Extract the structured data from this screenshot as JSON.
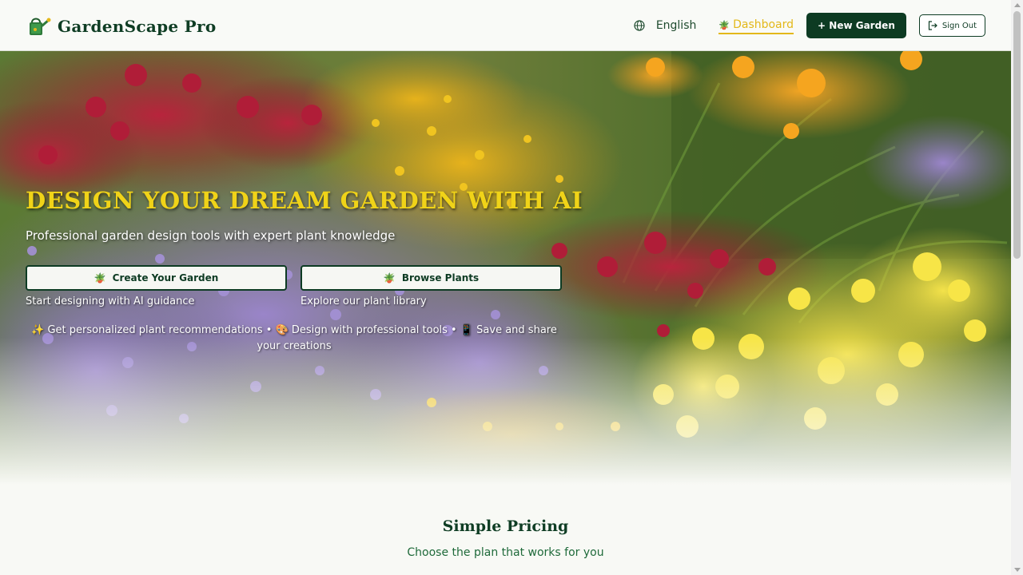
{
  "app": {
    "name": "GardenScape Pro"
  },
  "nav": {
    "language": "English",
    "dashboard": "Dashboard",
    "new_garden": "+ New Garden",
    "sign_out": "Sign Out"
  },
  "hero": {
    "title": "DESIGN YOUR DREAM GARDEN WITH AI",
    "subtitle": "Professional garden design tools with expert plant knowledge",
    "cta_create": {
      "label": "Create Your Garden",
      "note": "Start designing with AI guidance"
    },
    "cta_browse": {
      "label": "Browse Plants",
      "note": "Explore our plant library"
    },
    "features": "✨ Get personalized plant recommendations • 🎨 Design with professional tools • 📱 Save and share your creations"
  },
  "pricing": {
    "title": "Simple Pricing",
    "subtitle": "Choose the plan that works for you"
  },
  "icons": {
    "logo": "watering-can-icon",
    "language": "globe-icon",
    "dashboard": "trowel-icon",
    "sign_out": "sign-out-icon",
    "create": "trowel-icon",
    "browse": "plant-pot-icon"
  },
  "colors": {
    "brand_green": "#0d3b23",
    "accent_yellow": "#e3b81a",
    "hero_title": "#f0d318",
    "subtitle_green": "#1f6a3a"
  }
}
